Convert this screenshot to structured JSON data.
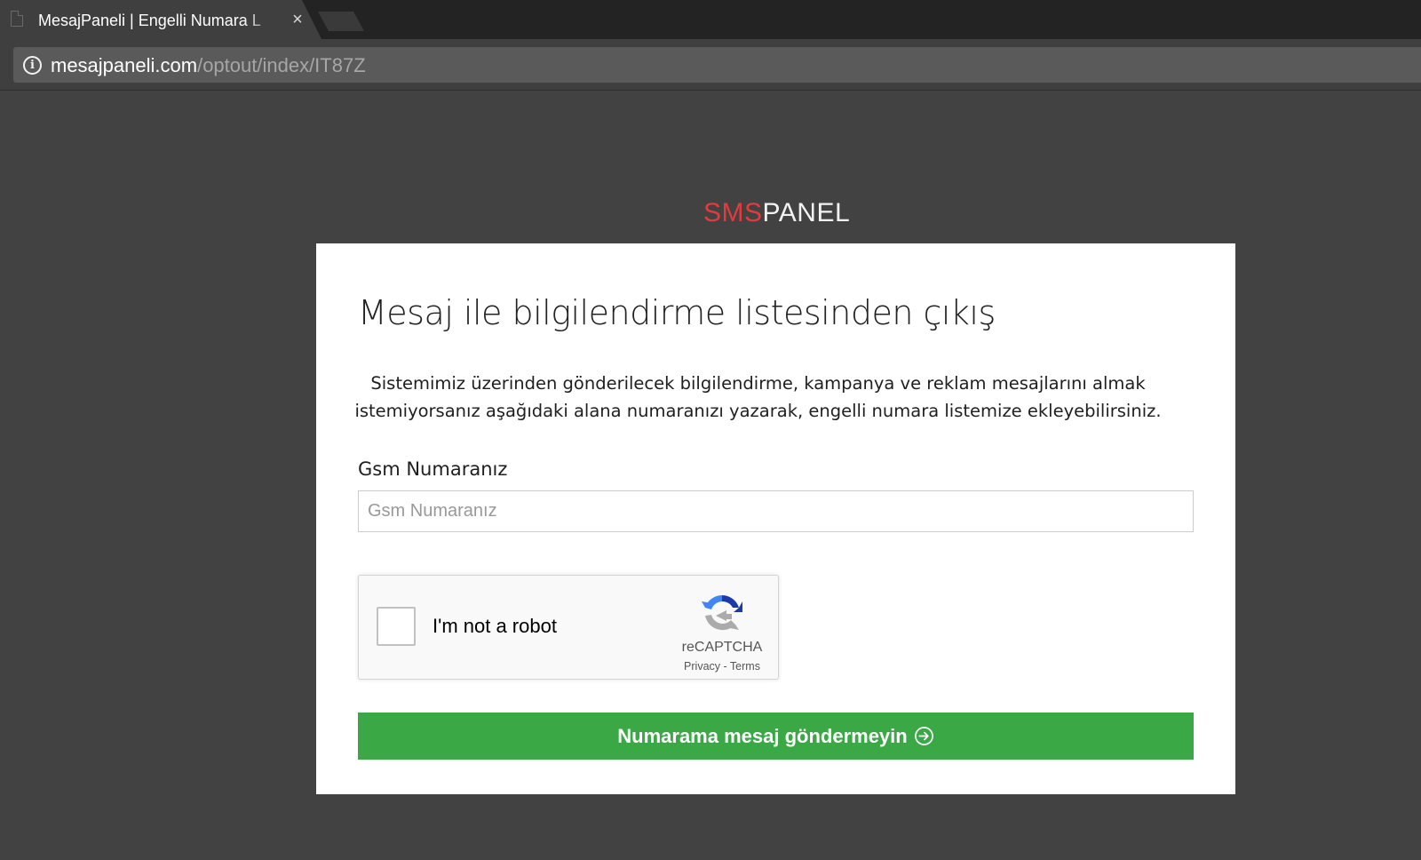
{
  "browser": {
    "tab_title": "MesajPaneli | Engelli Numara L",
    "tab_close": "×",
    "url_host": "mesajpaneli.com",
    "url_path": "/optout/index/IT87Z",
    "info_icon": "i"
  },
  "logo": {
    "part1": "SMS",
    "part2": "PANEL",
    "part1_color": "#e23b3b"
  },
  "form": {
    "heading": "Mesaj ile bilgilendirme listesinden çıkış",
    "description": "Sistemimiz üzerinden gönderilecek bilgilendirme, kampanya ve reklam mesajlarını almak istemiyorsanız aşağıdaki alana numaranızı yazarak, engelli numara listemize ekleyebilirsiniz.",
    "gsm_label": "Gsm Numaranız",
    "gsm_placeholder": "Gsm Numaranız",
    "gsm_value": "",
    "submit_label": "Numarama mesaj göndermeyin",
    "submit_icon": "arrow-right-circle-icon",
    "submit_color": "#39a845"
  },
  "recaptcha": {
    "label": "I'm not a robot",
    "brand": "reCAPTCHA",
    "privacy": "Privacy",
    "separator": " - ",
    "terms": "Terms",
    "checked": false
  }
}
